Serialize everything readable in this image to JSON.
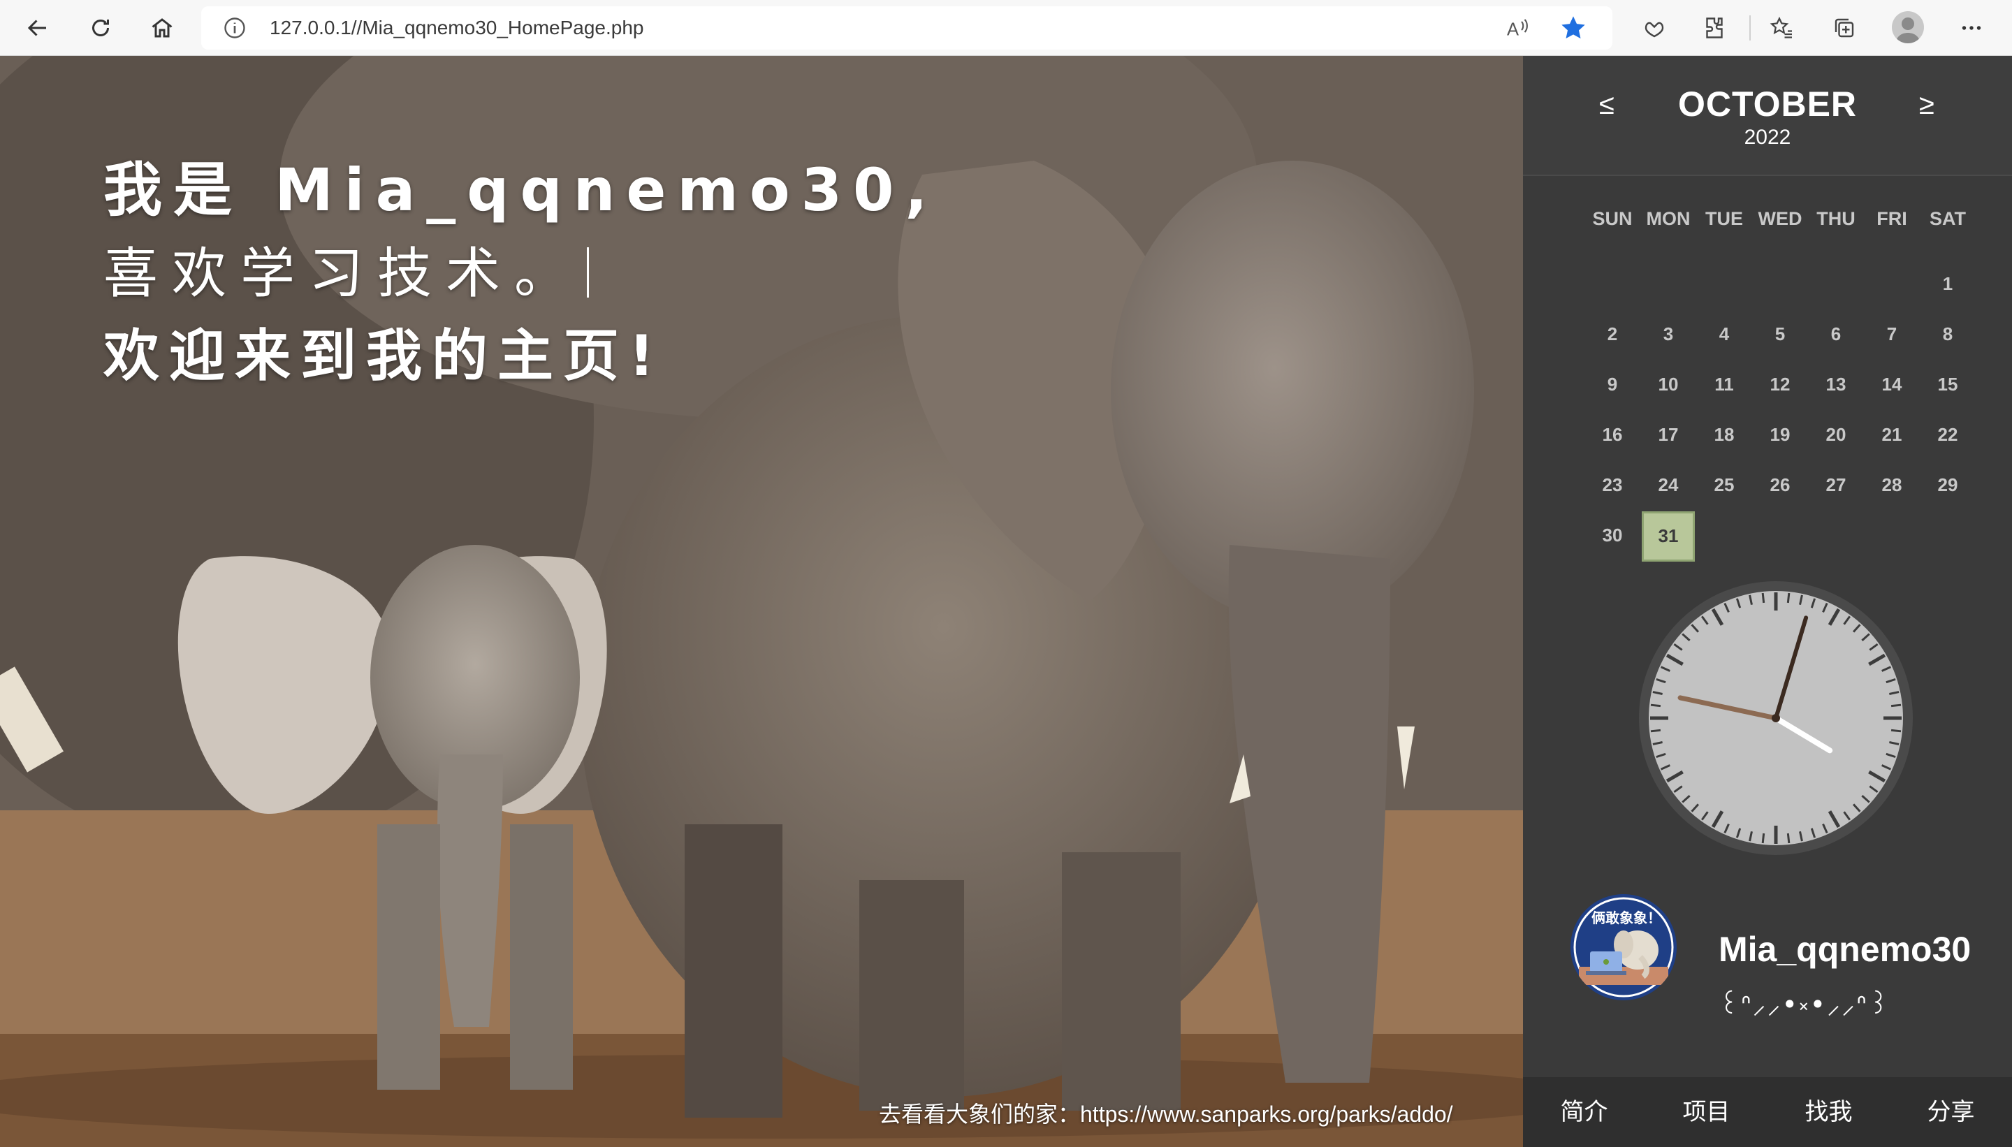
{
  "browser": {
    "url": "127.0.0.1//Mia_qqnemo30_HomePage.php"
  },
  "hero": {
    "line1": "我是 Mia_qqnemo30,",
    "line2": "喜欢学习技术。",
    "line3": "欢迎来到我的主页!",
    "link_text": "去看看大象们的家：https://www.sanparks.org/parks/addo/"
  },
  "calendar": {
    "prev": "≤",
    "next": "≥",
    "month": "OCTOBER",
    "year": "2022",
    "weekdays": [
      "SUN",
      "MON",
      "TUE",
      "WED",
      "THU",
      "FRI",
      "SAT"
    ],
    "first_weekday_index": 6,
    "days_in_month": 31,
    "today": 31
  },
  "clock": {
    "hour": 4,
    "minute": 2,
    "second": 47,
    "face_color": "#c2c2c2",
    "rim_color": "#4a4a4a"
  },
  "profile": {
    "name": "Mia_qqnemo30",
    "kaomoji": "꒰ᐢ⸝⸝•༝•⸝⸝ᐢ꒱",
    "avatar_banner": "俩敢象象！"
  },
  "nav": {
    "items": [
      "简介",
      "项目",
      "找我",
      "分享"
    ]
  },
  "colors": {
    "sidebar_bg": "#3a3a3a",
    "today_bg": "#b8c79a",
    "fav_star": "#1f6fe0"
  }
}
